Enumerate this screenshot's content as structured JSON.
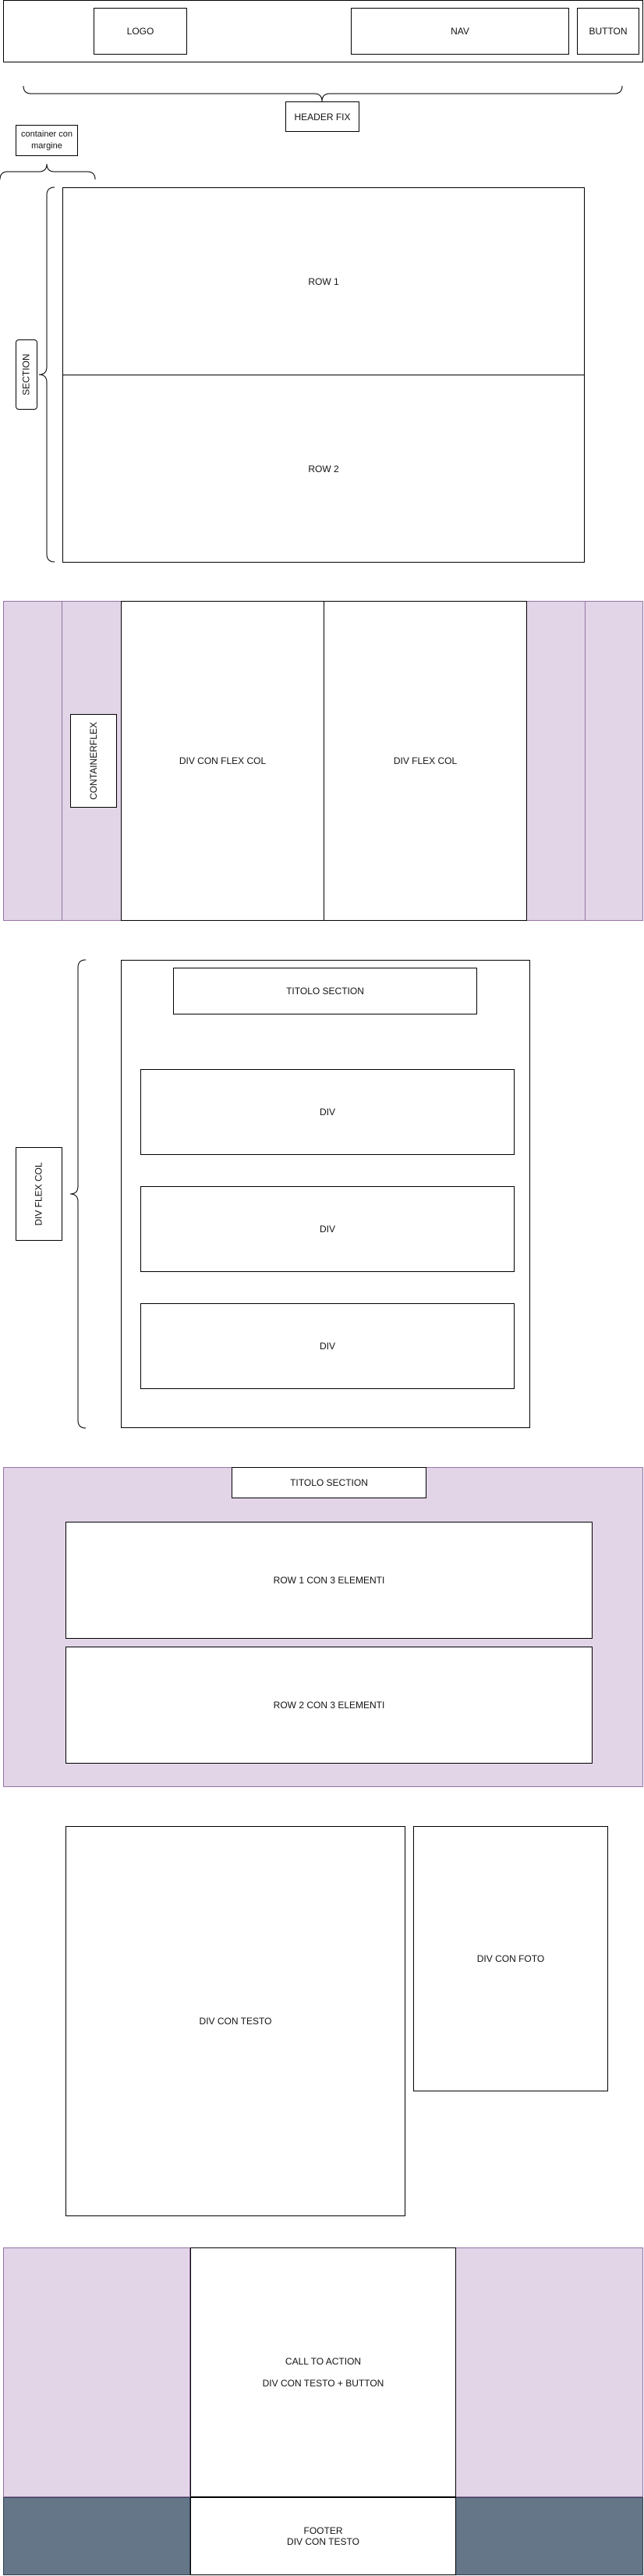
{
  "header": {
    "logo": "LOGO",
    "nav": "NAV",
    "button": "BUTTON",
    "note": "HEADER FIX"
  },
  "container_note": {
    "line1": "container con",
    "line2": "margine"
  },
  "section1": {
    "label": "SECTION",
    "rows": [
      "ROW 1",
      "ROW 2"
    ]
  },
  "section2": {
    "label": "CONTAINERFLEX",
    "col1": "DIV CON FLEX COL",
    "col2": "DIV FLEX COL"
  },
  "section3": {
    "label": "DIV FLEX COL",
    "title": "TITOLO SECTION",
    "divs": [
      "DIV",
      "DIV",
      "DIV"
    ]
  },
  "section4": {
    "title": "TITOLO SECTION",
    "row1": "ROW 1 CON 3 ELEMENTI",
    "row2": "ROW 2 CON 3 ELEMENTI"
  },
  "section5": {
    "text": "DIV CON TESTO",
    "photo": "DIV CON FOTO"
  },
  "section6": {
    "cta_line1": "CALL TO ACTION",
    "cta_line2": "DIV CON TESTO + BUTTON"
  },
  "footer": {
    "line1": "FOOTER",
    "line2": "DIV CON TESTO"
  },
  "colors": {
    "lilac": "#e1d5e7",
    "lilac_border": "#9673a6",
    "slate": "#647687",
    "slate_border": "#314354"
  }
}
